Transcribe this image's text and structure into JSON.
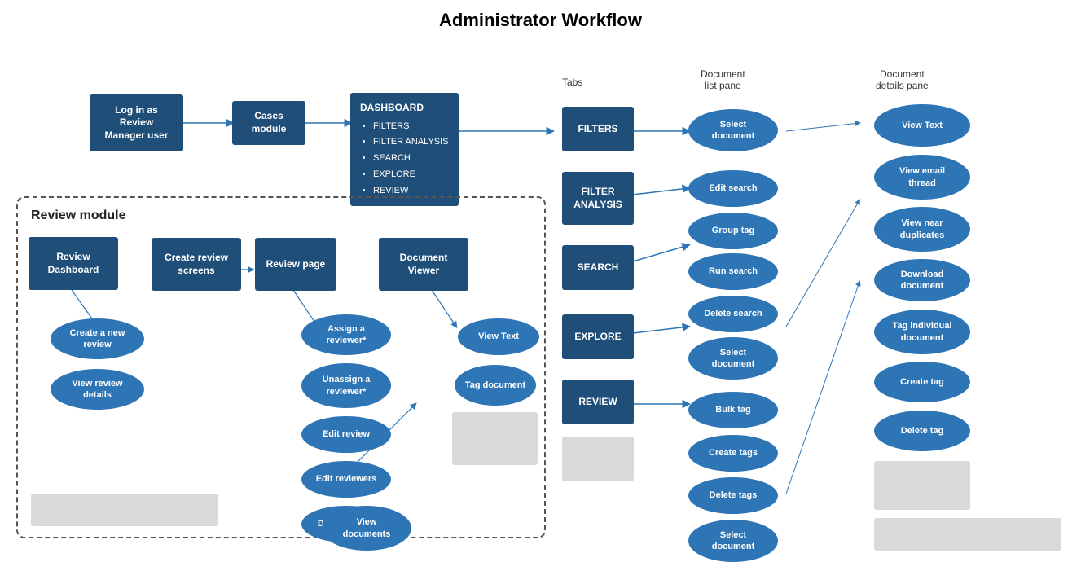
{
  "title": "Administrator Workflow",
  "sections": {
    "tabs_label": "Tabs",
    "doc_list_label": "Document\nlist pane",
    "doc_details_label": "Document\ndetails pane"
  },
  "top_flow": {
    "login_box": "Log in as\nReview\nManager user",
    "cases_box": "Cases\nmodule",
    "dashboard_title": "DASHBOARD",
    "dashboard_items": [
      "FILTERS",
      "FILTER ANALYSIS",
      "SEARCH",
      "EXPLORE",
      "REVIEW"
    ]
  },
  "review_module": {
    "title": "Review module",
    "boxes": [
      {
        "id": "review-dashboard",
        "label": "Review\nDashboard"
      },
      {
        "id": "create-review",
        "label": "Create review\nscreens"
      },
      {
        "id": "review-page",
        "label": "Review page"
      },
      {
        "id": "doc-viewer",
        "label": "Document\nViewer"
      }
    ],
    "dashboard_ovals": [
      {
        "id": "create-new-review",
        "label": "Create a new\nreview"
      },
      {
        "id": "view-review-details",
        "label": "View review\ndetails"
      }
    ],
    "review_page_ovals": [
      {
        "id": "assign-reviewer",
        "label": "Assign a\nreviewer*"
      },
      {
        "id": "unassign-reviewer",
        "label": "Unassign a\nreviewer*"
      },
      {
        "id": "edit-review",
        "label": "Edit review"
      },
      {
        "id": "edit-reviewers",
        "label": "Edit reviewers"
      },
      {
        "id": "delete-review",
        "label": "Delete review"
      },
      {
        "id": "view-documents",
        "label": "View\ndocuments"
      }
    ],
    "doc_viewer_ovals": [
      {
        "id": "view-text-inner",
        "label": "View Text"
      },
      {
        "id": "tag-document",
        "label": "Tag document"
      }
    ]
  },
  "tabs": [
    {
      "id": "tab-filters",
      "label": "FILTERS"
    },
    {
      "id": "tab-filter-analysis",
      "label": "FILTER\nANALYSIS"
    },
    {
      "id": "tab-search",
      "label": "SEARCH"
    },
    {
      "id": "tab-explore",
      "label": "EXPLORE"
    },
    {
      "id": "tab-review",
      "label": "REVIEW"
    }
  ],
  "doc_list_ovals": {
    "filters_group": [
      {
        "id": "select-doc-1",
        "label": "Select\ndocument"
      }
    ],
    "filter_analysis_group": [
      {
        "id": "edit-search",
        "label": "Edit search"
      },
      {
        "id": "group-tag",
        "label": "Group tag"
      },
      {
        "id": "run-search",
        "label": "Run search"
      },
      {
        "id": "delete-search",
        "label": "Delete search"
      },
      {
        "id": "select-doc-2",
        "label": "Select\ndocument"
      }
    ],
    "review_group": [
      {
        "id": "bulk-tag",
        "label": "Bulk tag"
      },
      {
        "id": "create-tags",
        "label": "Create tags"
      },
      {
        "id": "delete-tags",
        "label": "Delete tags"
      },
      {
        "id": "select-doc-3",
        "label": "Select\ndocument"
      }
    ]
  },
  "doc_details_ovals": [
    {
      "id": "view-text",
      "label": "View Text"
    },
    {
      "id": "view-email-thread",
      "label": "View email\nthread"
    },
    {
      "id": "view-near-duplicates",
      "label": "View near\nduplicates"
    },
    {
      "id": "download-document",
      "label": "Download\ndocument"
    },
    {
      "id": "tag-individual",
      "label": "Tag individual\ndocument"
    },
    {
      "id": "create-tag",
      "label": "Create tag"
    },
    {
      "id": "delete-tag",
      "label": "Delete tag"
    }
  ]
}
